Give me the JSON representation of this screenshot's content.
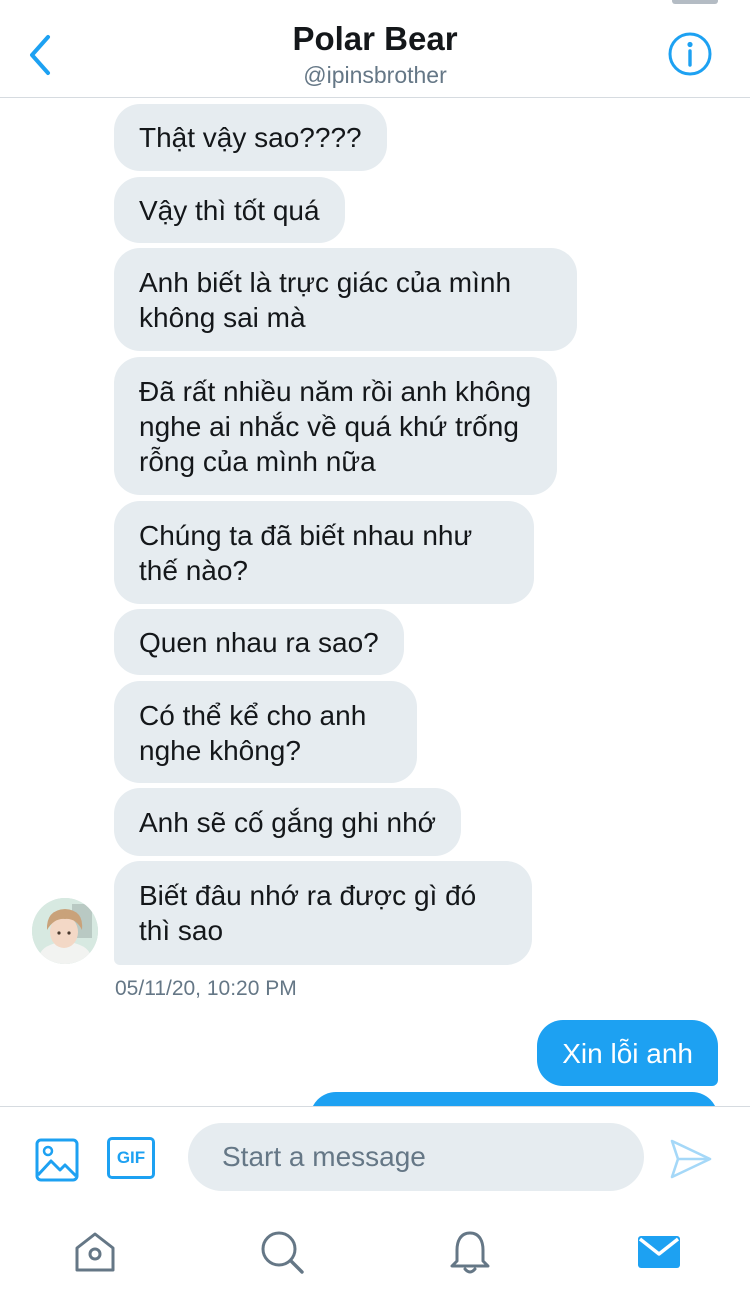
{
  "header": {
    "title": "Polar Bear",
    "handle": "@ipinsbrother"
  },
  "conversation": {
    "received": [
      "Thật vậy sao????",
      "Vậy thì tốt quá",
      "Anh biết là trực giác của mình không sai mà",
      "Đã rất nhiều năm rồi anh không nghe ai nhắc về quá khứ trống rỗng của mình nữa",
      "Chúng ta đã biết nhau như thế nào?",
      "Quen nhau ra sao?",
      "Có thể kể cho anh nghe không?",
      "Anh sẽ cố gắng ghi nhớ",
      "Biết đâu nhớ ra được gì đó thì sao"
    ],
    "timestamp": "05/11/20, 10:20 PM",
    "sent": [
      "Xin lỗi anh"
    ]
  },
  "composer": {
    "placeholder": "Start a message",
    "gif_label": "GIF"
  },
  "icons": {
    "back": "chevron-left-icon",
    "info": "info-icon",
    "media": "image-icon",
    "send": "send-icon",
    "home": "home-icon",
    "search": "search-icon",
    "notifications": "bell-icon",
    "messages": "mail-icon"
  },
  "colors": {
    "accent": "#1da1f2",
    "received_bubble": "#e6ecf0",
    "secondary_text": "#657786"
  }
}
